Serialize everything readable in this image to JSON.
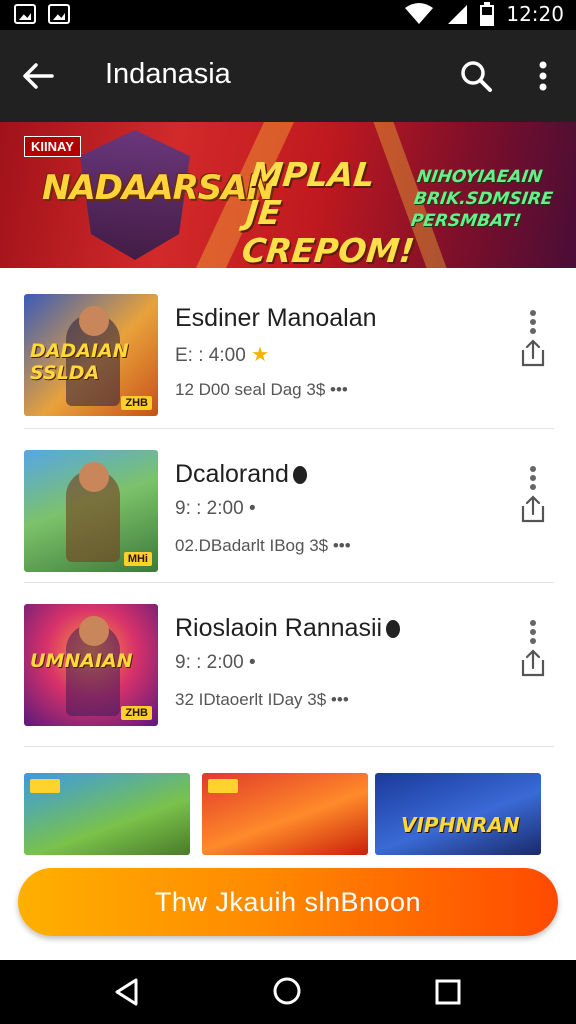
{
  "status_bar": {
    "time": "12:20"
  },
  "app_bar": {
    "title": "Indanasia"
  },
  "banner": {
    "tag": "KIINAY",
    "brand": "NADAARSAN",
    "headline": "MPLAL JE CREPOM!",
    "subline": "NIHOYIAEAIN BRIK.SDMSIRE PERSMBAT!"
  },
  "items": [
    {
      "name": "Esdiner Manoalan",
      "meta": "E: : 4:00",
      "sub": "12 D00 seal Dag 3$ •••",
      "thumb_title": "DADAIAN SSLDA",
      "thumb_badge": "ZHB"
    },
    {
      "name": "Dcalorand",
      "meta": "9: : 2:00 •",
      "sub": "02.DBadarlt IBog 3$ •••",
      "thumb_title": "",
      "thumb_badge": "MHi"
    },
    {
      "name": "Rioslaoin Rannasii",
      "meta": "9: : 2:00 •",
      "sub": "32 IDtaoerlt IDay 3$ •••",
      "thumb_title": "UMNAIAN",
      "thumb_badge": "ZHB"
    }
  ],
  "tiles": [
    {
      "title": ""
    },
    {
      "title": ""
    },
    {
      "title": "VIPHNRAN"
    }
  ],
  "cta": {
    "label": "Thw Jkauih slnBnoon"
  },
  "colors": {
    "app_bar": "#212121",
    "cta_start": "#ffb000",
    "cta_end": "#ff4a00",
    "banner_red": "#c0191f"
  }
}
